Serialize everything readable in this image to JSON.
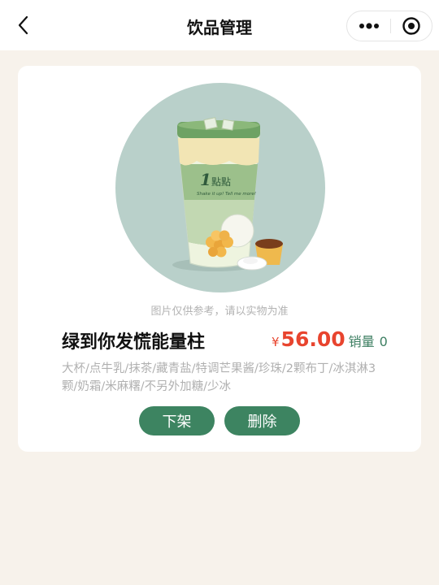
{
  "nav": {
    "title": "饮品管理",
    "back_icon": "chevron-left-icon",
    "more_icon": "more-dots-icon",
    "close_icon": "target-circle-icon"
  },
  "product": {
    "image_note": "图片仅供参考，请以实物为准",
    "name": "绿到你发慌能量柱",
    "currency": "¥",
    "price": "56.00",
    "sales_label": "销量",
    "sales_value": "0",
    "description": "大杯/点牛乳/抹茶/藏青盐/特调芒果酱/珍珠/2颗布丁/冰淇淋3颗/奶霜/米麻糬/不另外加糖/少冰",
    "cup_logo": "1点点",
    "cup_slogan": "Shake it up! Tell me more!"
  },
  "actions": {
    "take_down_label": "下架",
    "delete_label": "删除"
  },
  "colors": {
    "accent": "#3d8461",
    "price": "#e8442e",
    "background": "#f7f2eb"
  }
}
